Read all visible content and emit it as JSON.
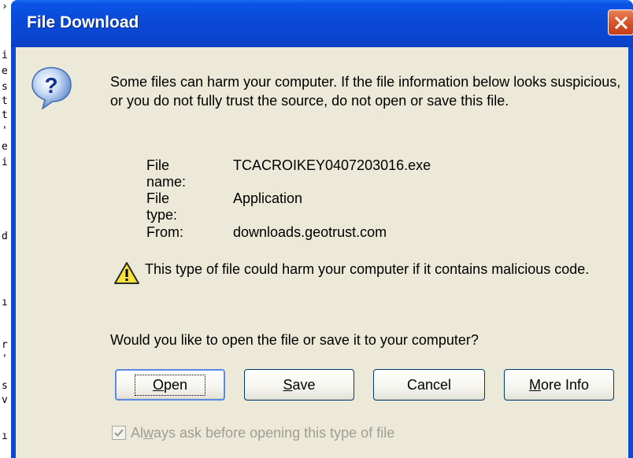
{
  "dialog": {
    "title": "File Download",
    "close_icon": "close-icon",
    "message": "Some files can harm your computer. If the file information below looks suspicious, or you do not fully trust the source, do not open or save this file.",
    "file_info": {
      "name_label": "File name:",
      "name_value": "TCACROIKEY0407203016.exe",
      "type_label": "File type:",
      "type_value": "Application",
      "from_label": "From:",
      "from_value": "downloads.geotrust.com"
    },
    "warning": "This type of file could harm your computer if it contains malicious code.",
    "question": "Would you like to open the file or save it to your computer?",
    "buttons": {
      "open": {
        "prefix": "",
        "accel": "O",
        "rest": "pen"
      },
      "save": {
        "prefix": "",
        "accel": "S",
        "rest": "ave"
      },
      "cancel": "Cancel",
      "more_info": {
        "prefix": "",
        "accel": "M",
        "rest": "ore Info"
      }
    },
    "checkbox": {
      "checked": true,
      "label_prefix": "Al",
      "label_accel": "w",
      "label_rest": "ays ask before opening this type of file"
    }
  },
  "icons": {
    "question": "question-icon",
    "warning": "warning-icon",
    "check": "check-icon"
  },
  "colors": {
    "titlebar": "#0a4ad6",
    "client": "#ece9d8",
    "close": "#d9532b"
  }
}
